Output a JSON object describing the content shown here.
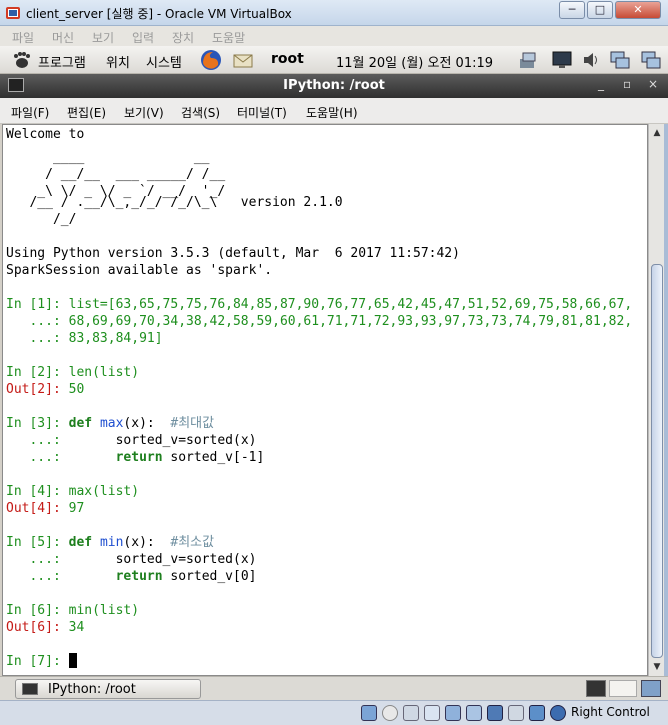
{
  "vbox": {
    "title": "client_server [실행 중] - Oracle VM VirtualBox",
    "min": "─",
    "max": "□",
    "close": "✕",
    "menu": [
      "파일",
      "머신",
      "보기",
      "입력",
      "장치",
      "도움말"
    ]
  },
  "gnome_panel": {
    "applications": "프로그램",
    "places": "위치",
    "system": "시스템",
    "user": "root",
    "clock": "11월 20일 (월) 오전 01:19"
  },
  "terminal": {
    "title": "IPython: /root",
    "title_buttons": [
      "_",
      "▫",
      "×"
    ],
    "menu": [
      "파일(F)",
      "편집(E)",
      "보기(V)",
      "검색(S)",
      "터미널(T)",
      "도움말(H)"
    ]
  },
  "console": {
    "welcome": "Welcome to",
    "logo": [
      "      ____              __",
      "     / __/__  ___ _____/ /__",
      "    _\\ \\/ _ \\/ _ `/ __/  '_/",
      "   /__ / .__/\\_,_/_/ /_/\\_\\   version 2.1.0",
      "      /_/"
    ],
    "python_version": "Using Python version 3.5.3 (default, Mar  6 2017 11:57:42)",
    "spark_session": "SparkSession available as 'spark'.",
    "cells": {
      "c1_prompt": "In [1]: ",
      "c1_code1": "list=[63,65,75,75,76,84,85,87,90,76,77,65,42,45,47,51,52,69,75,58,66,67,",
      "cont_prompt": "   ...: ",
      "c1_code2": "68,69,69,70,34,38,42,58,59,60,61,71,71,72,93,93,97,73,73,74,79,81,81,82,",
      "c1_code3": "83,83,84,91]",
      "c2_prompt": "In [2]: ",
      "c2_code": "len(list)",
      "o2_prompt": "Out[2]: ",
      "o2_value": "50",
      "c3_prompt": "In [3]: ",
      "def_kw": "def",
      "c3_fn": "max",
      "c3_sig": "(x):",
      "c3_comment": "#최대값",
      "c3_body1": "sorted_v=sorted(x)",
      "return_kw": "return",
      "c3_body2": "sorted_v[-1]",
      "c4_prompt": "In [4]: ",
      "c4_code": "max(list)",
      "o4_prompt": "Out[4]: ",
      "o4_value": "97",
      "c5_prompt": "In [5]: ",
      "c5_fn": "min",
      "c5_sig": "(x):",
      "c5_comment": "#최소값",
      "c5_body1": "sorted_v=sorted(x)",
      "c5_body2": "sorted_v[0]",
      "c6_prompt": "In [6]: ",
      "c6_code": "min(list)",
      "o6_prompt": "Out[6]: ",
      "o6_value": "34",
      "c7_prompt": "In [7]: "
    }
  },
  "taskbar": {
    "window_button": "IPython: /root"
  },
  "status": {
    "host_key": "Right Control"
  },
  "colors": {
    "prompt_in": "#1e8f1e",
    "prompt_out": "#c41a16",
    "keyword": "#1e7f1e",
    "function_name": "#1f4fd0",
    "comment": "#6f8fa0",
    "terminal_title_bg": "#3a3a3a"
  },
  "icons": [
    "virtualbox-icon",
    "gnome-foot-icon",
    "firefox-icon",
    "mail-icon",
    "network-icon",
    "display-icon",
    "volume-icon",
    "network-monitor-icon",
    "terminal-icon"
  ]
}
